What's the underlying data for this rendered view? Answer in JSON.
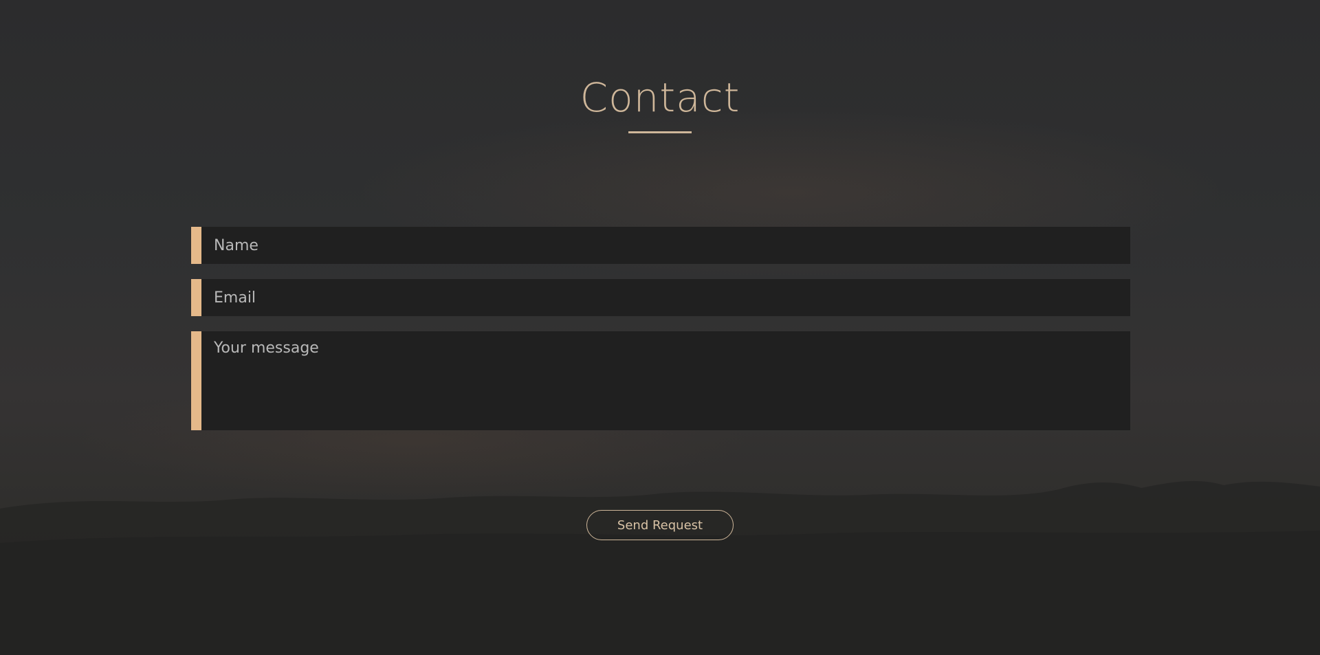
{
  "heading": {
    "title": "Contact"
  },
  "form": {
    "name_placeholder": "Name",
    "email_placeholder": "Email",
    "message_placeholder": "Your message",
    "submit_label": "Send Request"
  },
  "colors": {
    "accent": "#e5b98a",
    "heading": "#cfb79a",
    "field_background": "#202020",
    "page_background": "#2f3031"
  },
  "icons": {
    "background": "sunset-landscape-background-image"
  }
}
